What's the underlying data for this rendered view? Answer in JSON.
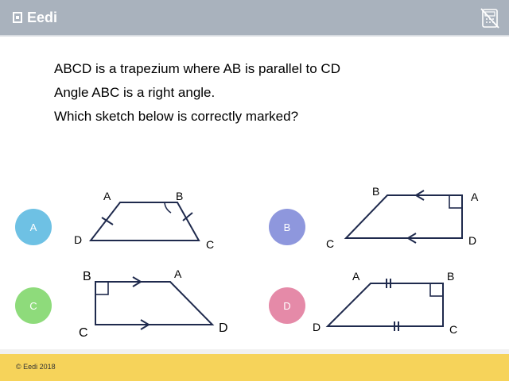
{
  "header": {
    "logo_text": "Eedi",
    "calculator_icon": "calculator-crossed-icon"
  },
  "question": {
    "line1": "ABCD is a trapezium where AB is parallel to CD",
    "line2": "Angle ABC is a right angle.",
    "line3": "Which sketch below is correctly marked?"
  },
  "options": [
    {
      "letter": "A",
      "color": "#6ec1e4",
      "labels": {
        "a": "A",
        "b": "B",
        "c": "C",
        "d": "D"
      }
    },
    {
      "letter": "B",
      "color": "#8e97dd",
      "labels": {
        "a": "A",
        "b": "B",
        "c": "C",
        "d": "D"
      }
    },
    {
      "letter": "C",
      "color": "#8edb7b",
      "labels": {
        "a": "A",
        "b": "B",
        "c": "C",
        "d": "D"
      }
    },
    {
      "letter": "D",
      "color": "#e58aa8",
      "labels": {
        "a": "A",
        "b": "B",
        "c": "C",
        "d": "D"
      }
    }
  ],
  "footer": {
    "copyright": "© Eedi 2018"
  }
}
